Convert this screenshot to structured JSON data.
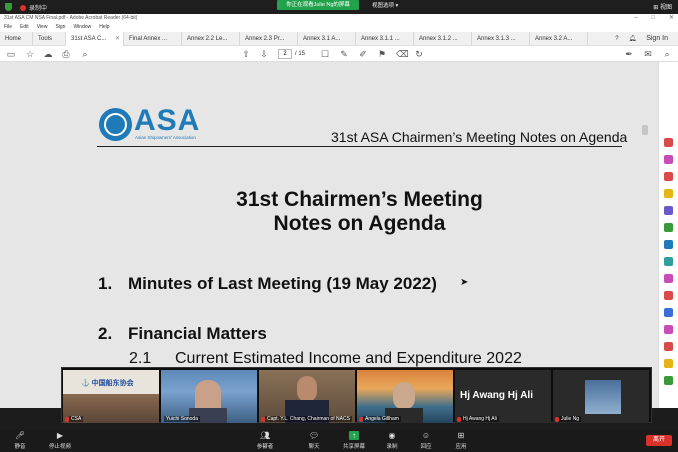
{
  "zoom_top": {
    "recording": "录制中",
    "viewing_banner": "你正在观看Julie Ng的屏幕",
    "view_options": "视图选项 ▾",
    "view_button": "视图"
  },
  "acrobat": {
    "title": "31st ASA CM NSA Final.pdf - Adobe Acrobat Reader (64-bit)",
    "menu": [
      "File",
      "Edit",
      "View",
      "Sign",
      "Window",
      "Help"
    ],
    "tabs": [
      "Home",
      "Tools",
      "31st ASA C...",
      "Final Annex ...",
      "Annex 2.2 Le...",
      "Annex 2.3 Pr...",
      "Annex 3.1 A...",
      "Annex 3.1.1 ...",
      "Annex 3.1.2 ...",
      "Annex 3.1.3 ...",
      "Annex 3.2 A..."
    ],
    "sign_in": "Sign In",
    "page_current": "2",
    "page_total": "/ 15"
  },
  "document": {
    "logo_text": "ASA",
    "logo_subtitle": "Asian Shipowners' Association",
    "header": "31st ASA Chairmen’s Meeting Notes on Agenda",
    "title_line1": "31st Chairmen’s Meeting",
    "title_line2": "Notes on Agenda",
    "items": [
      {
        "num": "1.",
        "text": "Minutes of Last Meeting (19 May 2022)"
      },
      {
        "num": "2.",
        "text": "Financial Matters"
      }
    ],
    "subitem": {
      "num": "2.1",
      "text": "Current Estimated Income and Expenditure 2022"
    }
  },
  "participants": [
    {
      "name": "CSA"
    },
    {
      "name": "Yuichi Sonoda"
    },
    {
      "name": "Capt. Y.L. Chang, Chairman of NACS"
    },
    {
      "name": "Angela Gillham"
    },
    {
      "name": "Hj Awang Hj Ali",
      "big_name": "Hj Awang Hj Ali"
    },
    {
      "name": "Julie Ng"
    }
  ],
  "zoom_bottom": {
    "mute": "静音",
    "stop_video": "停止视频",
    "participants": "参会者",
    "participant_count": "17",
    "chat": "聊天",
    "share": "共享屏幕",
    "record": "录制",
    "reactions": "回应",
    "apps": "应用",
    "leave": "离开"
  }
}
